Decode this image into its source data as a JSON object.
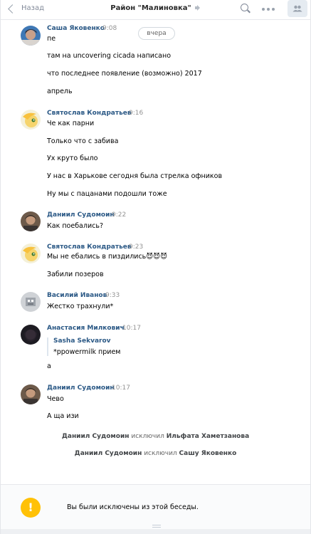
{
  "header": {
    "back_label": "Назад",
    "title": "Район \"Малиновка\""
  },
  "date_divider": "вчера",
  "messages": [
    {
      "author": "Саша Яковенко",
      "time": "9:08",
      "avatar": "sasha-avatar",
      "lines": [
        "пе",
        "там на uncovering cicada написано",
        "что последнее появление (возможно) 2017",
        "апрель"
      ]
    },
    {
      "author": "Святослав Кондратьев",
      "time": "9:16",
      "avatar": "pony-avatar",
      "lines": [
        "Че как парни",
        "Только что с забива",
        "Ух круто было",
        "У нас в Харькове сегодня была стрелка офников",
        "Ну мы с пацанами подошли тоже"
      ]
    },
    {
      "author": "Даниил Судомоин",
      "time": "9:22",
      "avatar": "daniil-avatar",
      "lines": [
        "Как поебались?"
      ]
    },
    {
      "author": "Святослав Кондратьев",
      "time": "9:23",
      "avatar": "pony-avatar",
      "lines": [
        "Мы не ебались в пиздились😈😈😈",
        "Забили позеров"
      ]
    },
    {
      "author": "Василий Иванов",
      "time": "9:33",
      "avatar": "vasily-avatar",
      "lines": [
        "Жестко трахнули*"
      ]
    },
    {
      "author": "Анастасия Милкович",
      "time": "10:17",
      "avatar": "anastasia-avatar",
      "quote": {
        "author": "Sasha Sekvarov",
        "text": "*ppowermilk прием"
      },
      "lines": [
        "а"
      ]
    },
    {
      "author": "Даниил Судомоин",
      "time": "10:17",
      "avatar": "daniil-avatar",
      "lines": [
        "Чево",
        "А ща изи"
      ]
    }
  ],
  "service": [
    {
      "actor": "Даниил Судомоин",
      "verb": "исключил",
      "target": "Ильфата Хаметзанова"
    },
    {
      "actor": "Даниил Судомоин",
      "verb": "исключил",
      "target": "Сашу Яковенко"
    }
  ],
  "footer": {
    "warning_glyph": "!",
    "text": "Вы были исключены из этой беседы."
  },
  "colors": {
    "author": "#2a5885",
    "warning": "#ffc107",
    "header_border": "#e7e8ec"
  }
}
